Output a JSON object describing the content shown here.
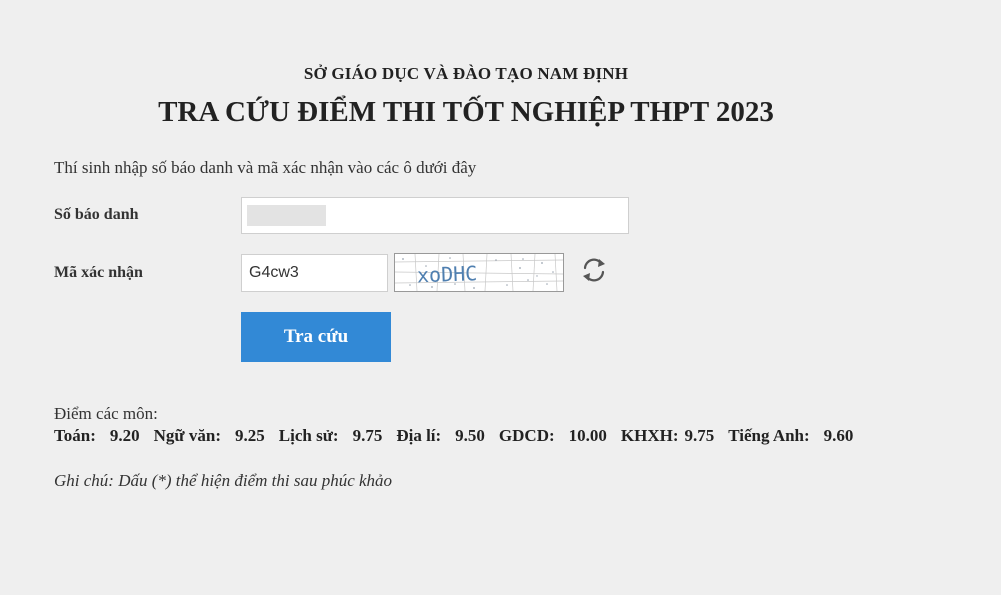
{
  "header": {
    "agency": "SỞ GIÁO DỤC VÀ ĐÀO TẠO NAM ĐỊNH",
    "title": "TRA CỨU ĐIỂM THI TỐT NGHIỆP THPT 2023"
  },
  "form": {
    "instruction": "Thí sinh nhập số báo danh và mã xác nhận vào các ô dưới đây",
    "candidate_number_label": "Số báo danh",
    "candidate_number_value": "",
    "captcha_label": "Mã xác nhận",
    "captcha_input_value": "G4cw3",
    "captcha_image_text": "xoDHC",
    "refresh_icon": "refresh-icon",
    "submit_label": "Tra cứu",
    "submit_color": "#3289d6"
  },
  "results": {
    "heading": "Điểm các môn:",
    "subjects": [
      {
        "name": "Toán:",
        "score": "9.20"
      },
      {
        "name": "Ngữ văn:",
        "score": "9.25"
      },
      {
        "name": "Lịch sử:",
        "score": "9.75"
      },
      {
        "name": "Địa lí:",
        "score": "9.50"
      },
      {
        "name": "GDCD:",
        "score": "10.00"
      },
      {
        "name": "KHXH:",
        "score": "9.75"
      },
      {
        "name": "Tiếng Anh:",
        "score": "9.60"
      }
    ],
    "note": "Ghi chú: Dấu (*) thể hiện điểm thi sau phúc khảo"
  }
}
